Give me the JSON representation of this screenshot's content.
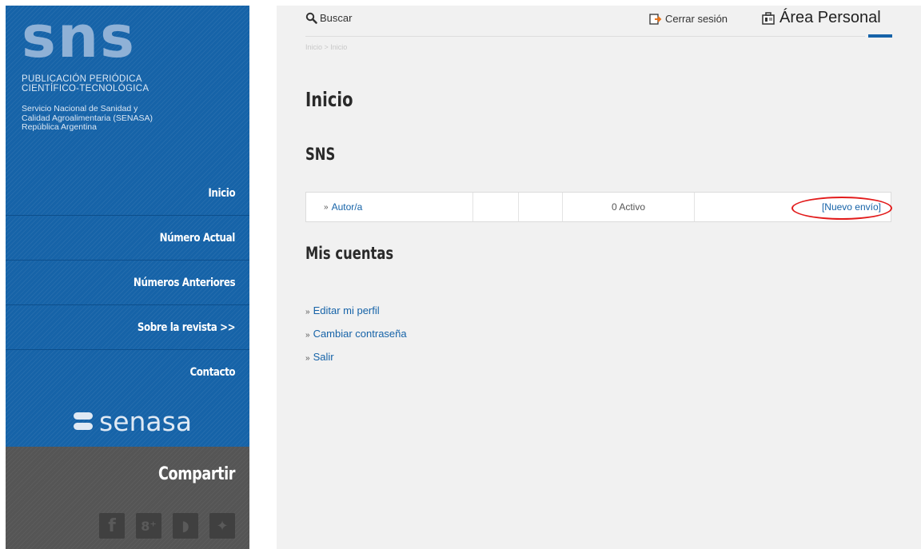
{
  "sidebar": {
    "logo_text": "sns",
    "publication_lines": [
      "PUBLICACIÓN   PERIÓDICA",
      "CIENTÍFICO-TECNOLÓGICA"
    ],
    "org_lines": [
      "Servicio Nacional de Sanidad y",
      "Calidad Agroalimentaria (SENASA)",
      "República Argentina"
    ],
    "nav": [
      {
        "label": "Inicio"
      },
      {
        "label": "Número Actual"
      },
      {
        "label": "Números Anteriores"
      },
      {
        "label": "Sobre la revista >>"
      },
      {
        "label": "Contacto"
      }
    ],
    "senasa_logo": "senasa",
    "share": {
      "title": "Compartir",
      "icons": [
        "facebook-icon",
        "google-plus-icon",
        "rss-icon",
        "twitter-icon"
      ],
      "icon_glyphs": [
        "f",
        "8⁺",
        "◗",
        "✦"
      ]
    }
  },
  "topbar": {
    "search_label": "Buscar",
    "logout_label": "Cerrar sesión",
    "area_label": "Área Personal"
  },
  "breadcrumb": "Inicio > Inicio",
  "main": {
    "title": "Inicio",
    "journal_title": "SNS",
    "roles": [
      {
        "role": "Autor/a",
        "active": "0 Activo",
        "action": "[Nuevo envío]"
      }
    ],
    "accounts_title": "Mis cuentas",
    "account_links": [
      {
        "label": "Editar mi perfil"
      },
      {
        "label": "Cambiar contraseña"
      },
      {
        "label": "Salir"
      }
    ]
  },
  "colors": {
    "sidebar_blue": "#1663a8",
    "share_gray": "#555555",
    "main_bg": "#f1f1f1",
    "link_blue": "#1663a8",
    "annotation_red": "#e21b1b"
  }
}
